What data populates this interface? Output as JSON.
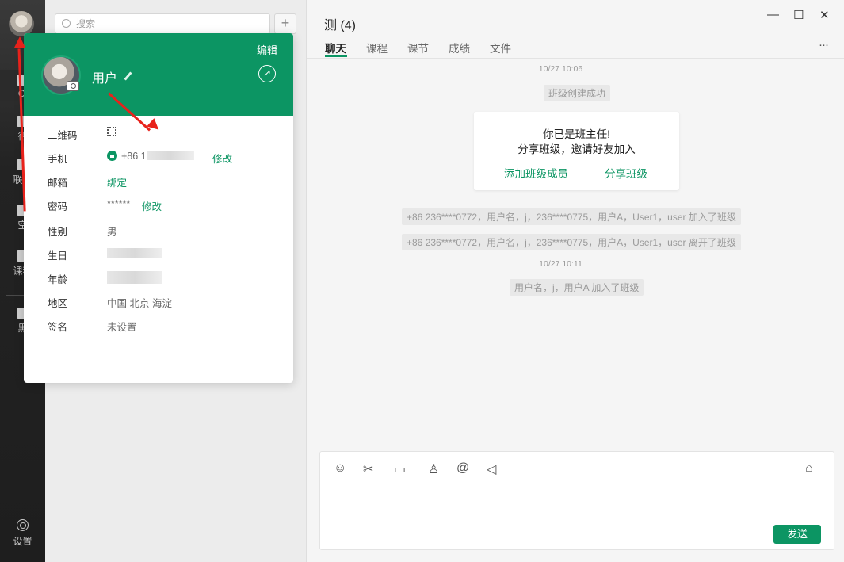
{
  "sidebar": {
    "items": [
      {
        "label": "Cl"
      },
      {
        "label": "待"
      },
      {
        "label": "联系"
      },
      {
        "label": "空"
      },
      {
        "label": "课程"
      },
      {
        "label": "黑"
      }
    ],
    "settings_label": "设置"
  },
  "list": {
    "search_placeholder": "搜索",
    "add_label": "+"
  },
  "profile": {
    "edit_label": "编辑",
    "name": "用户",
    "rows": [
      {
        "label": "二维码"
      },
      {
        "label": "手机",
        "value": "+86 1",
        "action": "修改"
      },
      {
        "label": "邮箱",
        "action": "绑定"
      },
      {
        "label": "密码",
        "value": "******",
        "action": "修改"
      },
      {
        "label": "性别",
        "value": "男"
      },
      {
        "label": "生日"
      },
      {
        "label": "年龄"
      },
      {
        "label": "地区",
        "value": "中国 北京 海淀"
      },
      {
        "label": "签名",
        "value": "未设置"
      }
    ]
  },
  "chat": {
    "title": "测 (4)",
    "window": {
      "minimize": "—",
      "maximize": "☐",
      "close": "✕"
    },
    "tabs": [
      {
        "label": "聊天"
      },
      {
        "label": "课程"
      },
      {
        "label": "课节"
      },
      {
        "label": "成绩"
      },
      {
        "label": "文件"
      }
    ],
    "more": "···",
    "ts1": "10/27 10:06",
    "sys_created": "班级创建成功",
    "card": {
      "line1": "你已是班主任!",
      "line2": "分享班级，邀请好友加入",
      "add_members": "添加班级成员",
      "share": "分享班级"
    },
    "sys_join": "+86 236****0772，用户名，j，236****0775，用户A，User1，user 加入了班级",
    "sys_leave": "+86 236****0772，用户名，j，236****0775，用户A，User1，user 离开了班级",
    "ts2": "10/27 10:11",
    "sys_join2": "用户名，j，用户A 加入了班级",
    "send_label": "发送"
  },
  "colors": {
    "accent": "#0c9563",
    "arrow": "#e8221b"
  }
}
